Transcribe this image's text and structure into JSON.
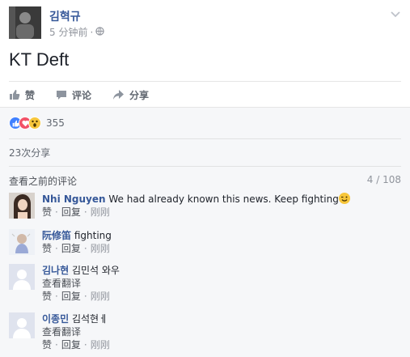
{
  "post": {
    "author": "김혁규",
    "time": "5 分钟前",
    "meta_separator": "·",
    "text": "KT Deft"
  },
  "actions": {
    "like_label": "赞",
    "comment_label": "评论",
    "share_label": "分享"
  },
  "reactions": {
    "count": "355",
    "icons": [
      "like-icon",
      "love-icon",
      "wow-icon"
    ],
    "colors": {
      "like": "#4080ff",
      "love": "#f25268",
      "wow": "#f7c63b"
    }
  },
  "shares": {
    "label": "23次分享"
  },
  "comments_header": {
    "view_previous": "查看之前的评论",
    "count": "4 / 108"
  },
  "comments": [
    {
      "name": "Nhi Nguyen",
      "text": "We had already known this news. Keep fighting",
      "has_emoji": true,
      "translate": "",
      "like": "赞",
      "reply": "回复",
      "time": "刚刚"
    },
    {
      "name": "阮修笛",
      "text": "fighting",
      "has_emoji": false,
      "translate": "",
      "like": "赞",
      "reply": "回复",
      "time": "刚刚"
    },
    {
      "name": "김나현",
      "text": "김민석 와우",
      "has_emoji": false,
      "translate": "查看翻译",
      "like": "赞",
      "reply": "回复",
      "time": "刚刚"
    },
    {
      "name": "이종민",
      "text": "김석현ㅔ",
      "has_emoji": false,
      "translate": "查看翻译",
      "like": "赞",
      "reply": "回复",
      "time": "刚刚"
    }
  ],
  "links_separator": "·"
}
